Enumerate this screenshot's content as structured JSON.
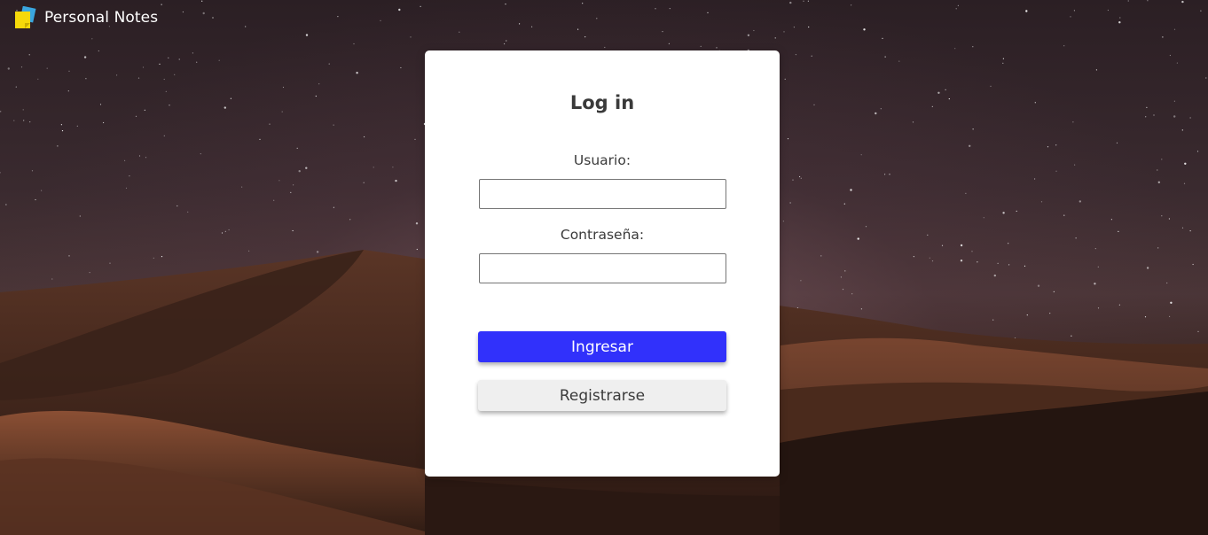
{
  "app": {
    "name": "Personal Notes",
    "icon": "sticky-notes-icon"
  },
  "login": {
    "title": "Log in",
    "username_label": "Usuario:",
    "username_value": "",
    "password_label": "Contraseña:",
    "password_value": "",
    "submit_label": "Ingresar",
    "register_label": "Registrarse"
  },
  "colors": {
    "primary_button": "#3131fb",
    "secondary_button": "#efefef",
    "card_background": "#ffffff",
    "text": "#3a3a3a"
  }
}
